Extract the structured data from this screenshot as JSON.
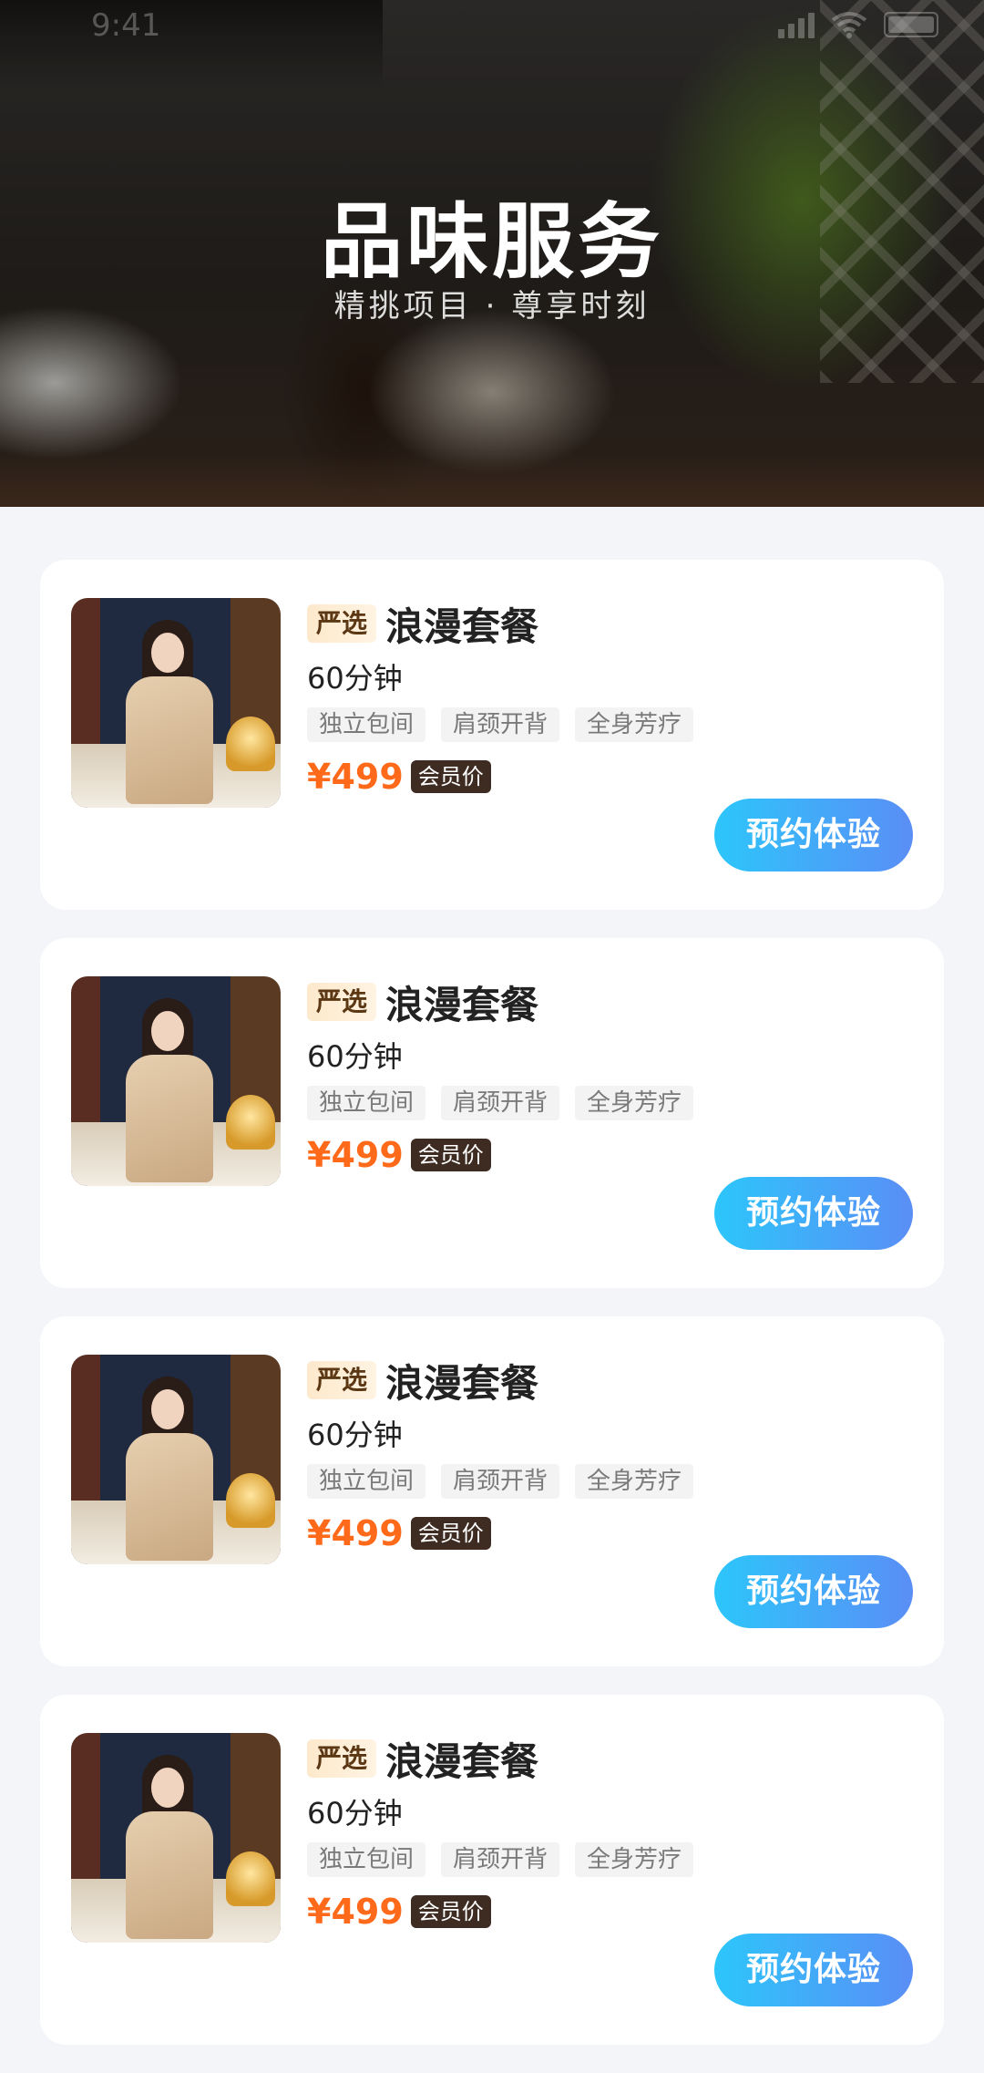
{
  "status_bar": {
    "time": "9:41"
  },
  "hero": {
    "title": "品味服务",
    "subtitle_left": "精挑项目",
    "subtitle_separator": "·",
    "subtitle_right": "尊享时刻"
  },
  "colors": {
    "price": "#ff6a1a",
    "button_gradient_start": "#2cc6fb",
    "button_gradient_end": "#5a8ef6",
    "member_badge_bg": "#3e2c22",
    "select_tag_bg": "#fde9cc",
    "page_bg": "#f4f5f9"
  },
  "cards": [
    {
      "select_tag": "严选",
      "title": "浪漫套餐",
      "duration": "60分钟",
      "features": [
        "独立包间",
        "肩颈开背",
        "全身芳疗"
      ],
      "price": "¥499",
      "member_label": "会员价",
      "button_label": "预约体验"
    },
    {
      "select_tag": "严选",
      "title": "浪漫套餐",
      "duration": "60分钟",
      "features": [
        "独立包间",
        "肩颈开背",
        "全身芳疗"
      ],
      "price": "¥499",
      "member_label": "会员价",
      "button_label": "预约体验"
    },
    {
      "select_tag": "严选",
      "title": "浪漫套餐",
      "duration": "60分钟",
      "features": [
        "独立包间",
        "肩颈开背",
        "全身芳疗"
      ],
      "price": "¥499",
      "member_label": "会员价",
      "button_label": "预约体验"
    },
    {
      "select_tag": "严选",
      "title": "浪漫套餐",
      "duration": "60分钟",
      "features": [
        "独立包间",
        "肩颈开背",
        "全身芳疗"
      ],
      "price": "¥499",
      "member_label": "会员价",
      "button_label": "预约体验"
    }
  ]
}
